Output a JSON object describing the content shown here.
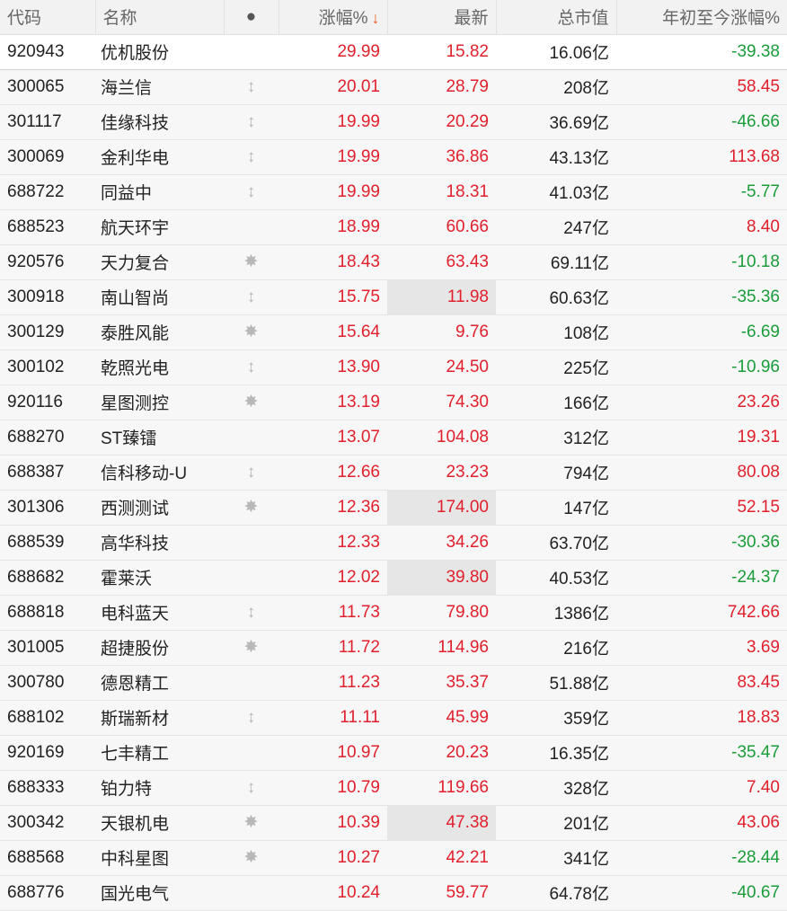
{
  "header": {
    "code": "代码",
    "name": "名称",
    "marker": "●",
    "change_pct": "涨幅%",
    "sort_arrow": "↓",
    "latest": "最新",
    "market_cap": "总市值",
    "ytd_change": "年初至今涨幅%"
  },
  "colors": {
    "up": "#e0202c",
    "down": "#1a9c3a",
    "sort_arrow": "#f05a28"
  },
  "rows": [
    {
      "code": "920943",
      "name": "优机股份",
      "icon": "",
      "change": "29.99",
      "latest": "15.82",
      "cap": "16.06亿",
      "ytd": "-39.38",
      "ytd_dir": "down",
      "hl": false
    },
    {
      "code": "300065",
      "name": "海兰信",
      "icon": "↕",
      "change": "20.01",
      "latest": "28.79",
      "cap": "208亿",
      "ytd": "58.45",
      "ytd_dir": "up",
      "hl": false
    },
    {
      "code": "301117",
      "name": "佳缘科技",
      "icon": "↕",
      "change": "19.99",
      "latest": "20.29",
      "cap": "36.69亿",
      "ytd": "-46.66",
      "ytd_dir": "down",
      "hl": false
    },
    {
      "code": "300069",
      "name": "金利华电",
      "icon": "↕",
      "change": "19.99",
      "latest": "36.86",
      "cap": "43.13亿",
      "ytd": "113.68",
      "ytd_dir": "up",
      "hl": false
    },
    {
      "code": "688722",
      "name": "同益中",
      "icon": "↕",
      "change": "19.99",
      "latest": "18.31",
      "cap": "41.03亿",
      "ytd": "-5.77",
      "ytd_dir": "down",
      "hl": false
    },
    {
      "code": "688523",
      "name": "航天环宇",
      "icon": "",
      "change": "18.99",
      "latest": "60.66",
      "cap": "247亿",
      "ytd": "8.40",
      "ytd_dir": "up",
      "hl": false
    },
    {
      "code": "920576",
      "name": "天力复合",
      "icon": "✸",
      "change": "18.43",
      "latest": "63.43",
      "cap": "69.11亿",
      "ytd": "-10.18",
      "ytd_dir": "down",
      "hl": false
    },
    {
      "code": "300918",
      "name": "南山智尚",
      "icon": "↕",
      "change": "15.75",
      "latest": "11.98",
      "cap": "60.63亿",
      "ytd": "-35.36",
      "ytd_dir": "down",
      "hl": true
    },
    {
      "code": "300129",
      "name": "泰胜风能",
      "icon": "✸",
      "change": "15.64",
      "latest": "9.76",
      "cap": "108亿",
      "ytd": "-6.69",
      "ytd_dir": "down",
      "hl": false
    },
    {
      "code": "300102",
      "name": "乾照光电",
      "icon": "↕",
      "change": "13.90",
      "latest": "24.50",
      "cap": "225亿",
      "ytd": "-10.96",
      "ytd_dir": "down",
      "hl": false
    },
    {
      "code": "920116",
      "name": "星图测控",
      "icon": "✸",
      "change": "13.19",
      "latest": "74.30",
      "cap": "166亿",
      "ytd": "23.26",
      "ytd_dir": "up",
      "hl": false
    },
    {
      "code": "688270",
      "name": "ST臻镭",
      "icon": "",
      "change": "13.07",
      "latest": "104.08",
      "cap": "312亿",
      "ytd": "19.31",
      "ytd_dir": "up",
      "hl": false
    },
    {
      "code": "688387",
      "name": "信科移动-U",
      "icon": "↕",
      "change": "12.66",
      "latest": "23.23",
      "cap": "794亿",
      "ytd": "80.08",
      "ytd_dir": "up",
      "hl": false
    },
    {
      "code": "301306",
      "name": "西测测试",
      "icon": "✸",
      "change": "12.36",
      "latest": "174.00",
      "cap": "147亿",
      "ytd": "52.15",
      "ytd_dir": "up",
      "hl": true
    },
    {
      "code": "688539",
      "name": "高华科技",
      "icon": "",
      "change": "12.33",
      "latest": "34.26",
      "cap": "63.70亿",
      "ytd": "-30.36",
      "ytd_dir": "down",
      "hl": false
    },
    {
      "code": "688682",
      "name": "霍莱沃",
      "icon": "",
      "change": "12.02",
      "latest": "39.80",
      "cap": "40.53亿",
      "ytd": "-24.37",
      "ytd_dir": "down",
      "hl": true
    },
    {
      "code": "688818",
      "name": "电科蓝天",
      "icon": "↕",
      "change": "11.73",
      "latest": "79.80",
      "cap": "1386亿",
      "ytd": "742.66",
      "ytd_dir": "up",
      "hl": false
    },
    {
      "code": "301005",
      "name": "超捷股份",
      "icon": "✸",
      "change": "11.72",
      "latest": "114.96",
      "cap": "216亿",
      "ytd": "3.69",
      "ytd_dir": "up",
      "hl": false
    },
    {
      "code": "300780",
      "name": "德恩精工",
      "icon": "",
      "change": "11.23",
      "latest": "35.37",
      "cap": "51.88亿",
      "ytd": "83.45",
      "ytd_dir": "up",
      "hl": false
    },
    {
      "code": "688102",
      "name": "斯瑞新材",
      "icon": "↕",
      "change": "11.11",
      "latest": "45.99",
      "cap": "359亿",
      "ytd": "18.83",
      "ytd_dir": "up",
      "hl": false
    },
    {
      "code": "920169",
      "name": "七丰精工",
      "icon": "",
      "change": "10.97",
      "latest": "20.23",
      "cap": "16.35亿",
      "ytd": "-35.47",
      "ytd_dir": "down",
      "hl": false
    },
    {
      "code": "688333",
      "name": "铂力特",
      "icon": "↕",
      "change": "10.79",
      "latest": "119.66",
      "cap": "328亿",
      "ytd": "7.40",
      "ytd_dir": "up",
      "hl": false
    },
    {
      "code": "300342",
      "name": "天银机电",
      "icon": "✸",
      "change": "10.39",
      "latest": "47.38",
      "cap": "201亿",
      "ytd": "43.06",
      "ytd_dir": "up",
      "hl": true
    },
    {
      "code": "688568",
      "name": "中科星图",
      "icon": "✸",
      "change": "10.27",
      "latest": "42.21",
      "cap": "341亿",
      "ytd": "-28.44",
      "ytd_dir": "down",
      "hl": false
    },
    {
      "code": "688776",
      "name": "国光电气",
      "icon": "",
      "change": "10.24",
      "latest": "59.77",
      "cap": "64.78亿",
      "ytd": "-40.67",
      "ytd_dir": "down",
      "hl": false
    }
  ]
}
